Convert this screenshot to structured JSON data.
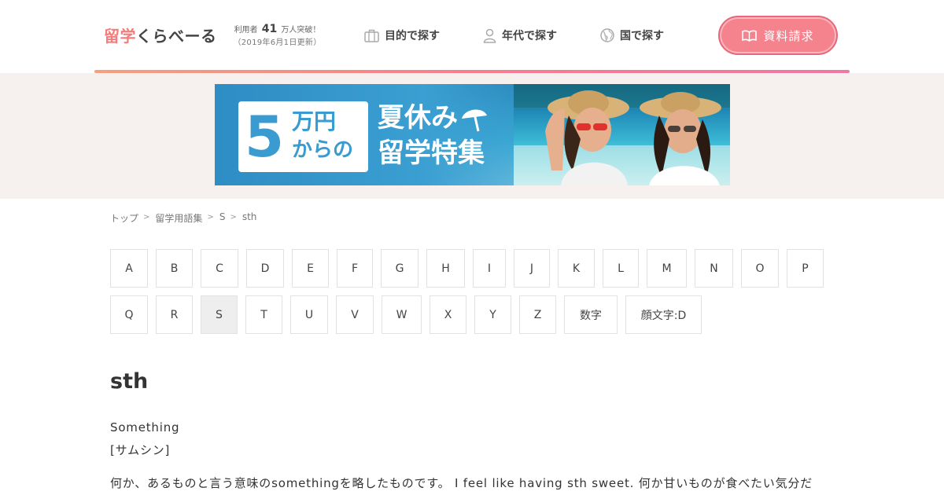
{
  "header": {
    "logo_accent": "留学",
    "logo_rest": "くらべーる",
    "users_prefix": "利用者",
    "users_count": "41",
    "users_suffix": "万人突破！",
    "users_date": "（2019年6月1日更新）",
    "nav": [
      {
        "label": "目的で探す",
        "icon": "suitcase-icon"
      },
      {
        "label": "年代で探す",
        "icon": "person-icon"
      },
      {
        "label": "国で探す",
        "icon": "globe-icon"
      }
    ],
    "cta_label": "資料請求",
    "cta_icon": "book-icon",
    "colors": {
      "accent": "#f4838e",
      "logo": "#f47c7c"
    }
  },
  "banner": {
    "big_number": "5",
    "unit": "万円",
    "from": "からの",
    "title_line1": "夏休み",
    "title_line2": "留学特集",
    "umbrella_icon": "beach-umbrella-icon"
  },
  "breadcrumb": [
    "トップ",
    "留学用語集",
    "S",
    "sth"
  ],
  "letters": {
    "row1": [
      "A",
      "B",
      "C",
      "D",
      "E",
      "F",
      "G",
      "H",
      "I",
      "J",
      "K",
      "L",
      "M",
      "N",
      "O",
      "P"
    ],
    "row2": [
      "Q",
      "R",
      "S",
      "T",
      "U",
      "V",
      "W",
      "X",
      "Y",
      "Z",
      "数字",
      "顔文字:D"
    ],
    "active": "S"
  },
  "term": {
    "title": "sth",
    "english": "Something",
    "reading": "[サムシン]",
    "description": "何か、あるものと言う意味のsomethingを略したものです。 I feel like having sth sweet. 何か甘いものが食べたい気分だ"
  }
}
